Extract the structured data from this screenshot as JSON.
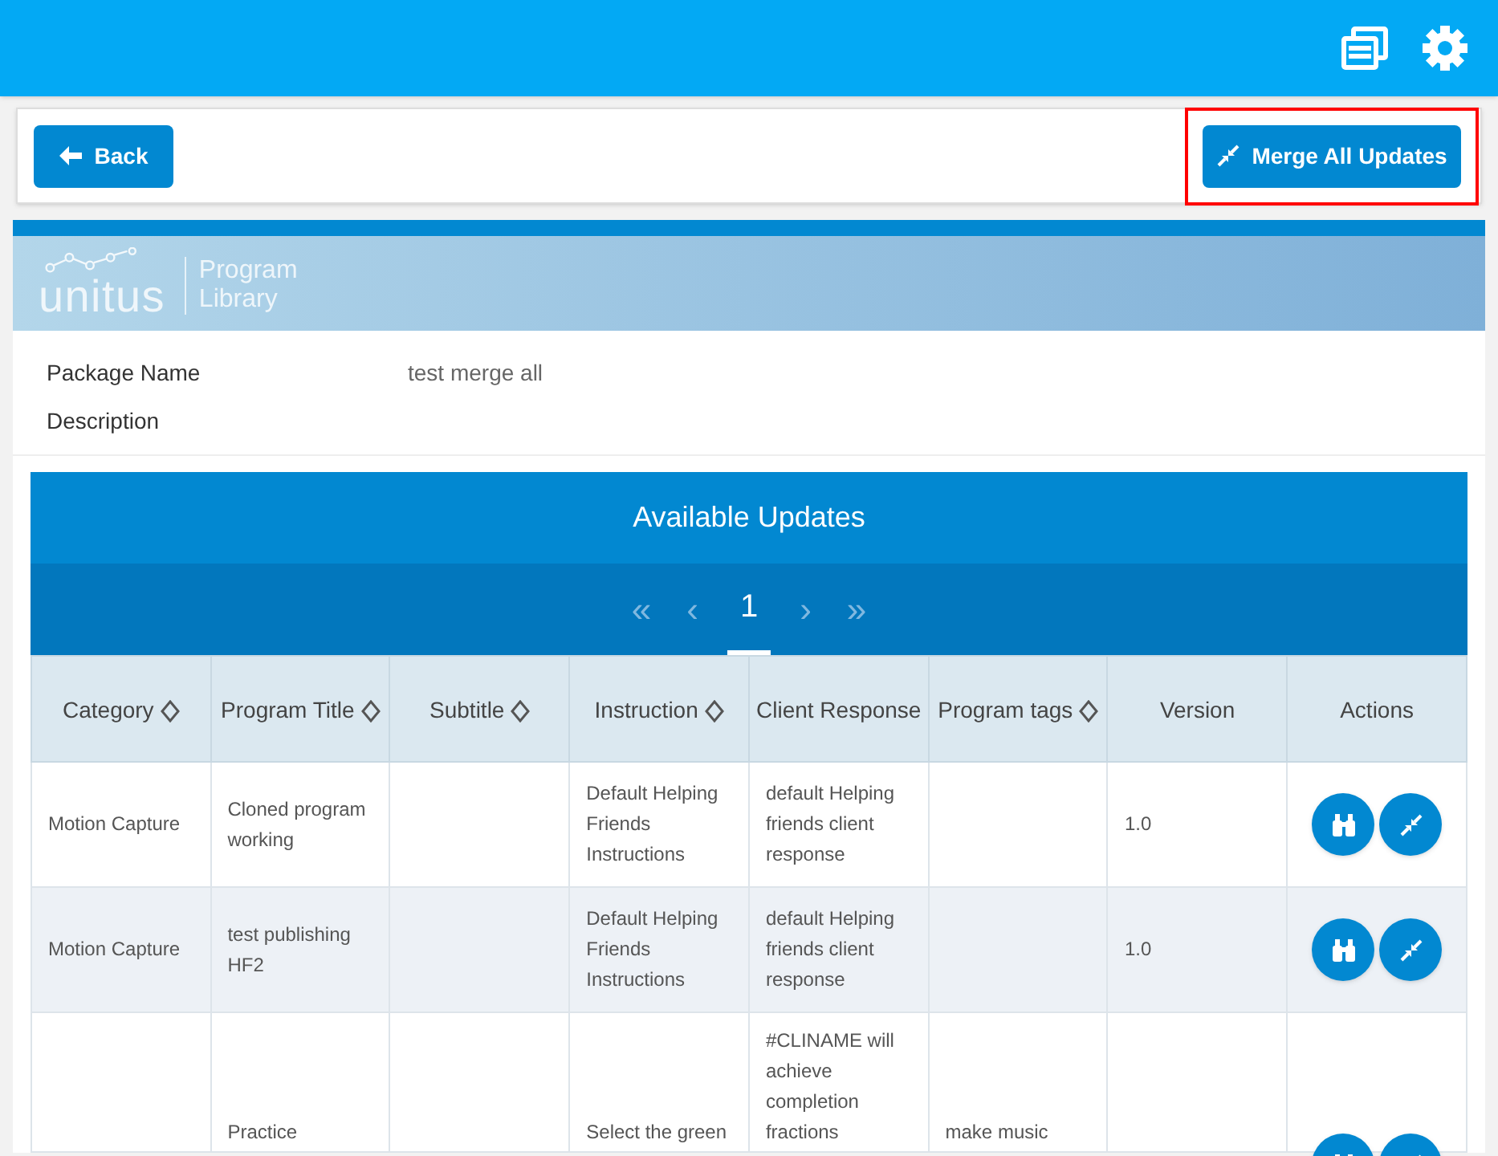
{
  "toolbar": {
    "back_button": "Back",
    "merge_button": {
      "label": "Merge All Updates",
      "highlighted": true
    }
  },
  "banner": {
    "logo": "unitus",
    "subtitle_lines": [
      "Program",
      "Library"
    ]
  },
  "details": [
    {
      "label": "Package Name",
      "value": "test merge all"
    },
    {
      "label": "Description"
    }
  ],
  "updates": {
    "title": "Available Updates",
    "pagination": {
      "first": "«",
      "prev": "‹",
      "pages": [
        {
          "label": "1",
          "selected": true
        }
      ],
      "next": "›",
      "last": "»"
    },
    "columns": [
      {
        "label": "Category",
        "sortable": true
      },
      {
        "label": "Program Title",
        "sortable": true
      },
      {
        "label": "Subtitle",
        "sortable": true
      },
      {
        "label": "Instruction",
        "sortable": true
      },
      {
        "label": "Client Response",
        "sortable": false
      },
      {
        "label": "Program tags",
        "sortable": true
      },
      {
        "label": "Version",
        "sortable": false
      },
      {
        "label": "Actions",
        "sortable": false
      }
    ],
    "rows": [
      {
        "cells": [
          "Motion Capture",
          "Cloned program working",
          "",
          "Default Helping Friends Instructions",
          "default Helping friends client response",
          "",
          "1.0"
        ]
      },
      {
        "cells": [
          "Motion Capture",
          "test publishing HF2",
          "",
          "Default Helping Friends Instructions",
          "default Helping friends client response",
          "",
          "1.0"
        ]
      },
      {
        "cells": [
          "",
          "Practice",
          "",
          "Select the green",
          "#CLINAME will achieve completion fractions",
          "make music",
          ""
        ]
      }
    ]
  }
}
